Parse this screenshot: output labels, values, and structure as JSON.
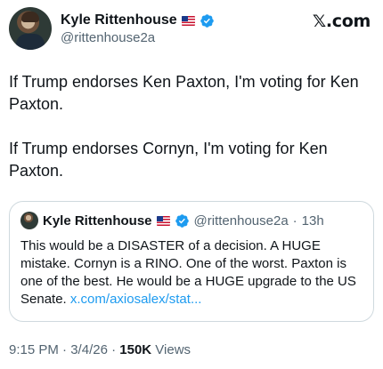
{
  "author": {
    "name": "Kyle Rittenhouse",
    "handle": "@rittenhouse2a"
  },
  "brand": "𝕏.com",
  "tweet": {
    "paragraphs": [
      "If Trump endorses Ken Paxton, I'm voting for Ken Paxton.",
      "If Trump endorses Cornyn, I'm voting for Ken Paxton."
    ]
  },
  "quote": {
    "name": "Kyle Rittenhouse",
    "handle": "@rittenhouse2a",
    "separator": "·",
    "time": "13h",
    "text": "This would be a DISASTER of a decision. A HUGE mistake. Cornyn is a RINO. One of the worst. Paxton is one of the best. He would be a HUGE upgrade to the US Senate. ",
    "link": "x.com/axiosalex/stat..."
  },
  "meta": {
    "time": "9:15 PM",
    "sep1": " · ",
    "date": "3/4/26",
    "sep2": " · ",
    "views_count": "150K",
    "views_label": " Views"
  },
  "colors": {
    "verified": "#1d9bf0",
    "link": "#1d9bf0",
    "secondary_text": "#536471"
  },
  "icons": [
    "verified-badge-icon",
    "us-flag-icon"
  ]
}
